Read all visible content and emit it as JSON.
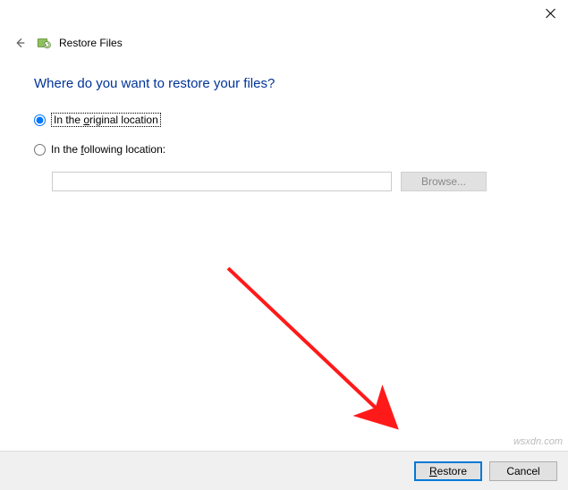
{
  "window": {
    "title": "Restore Files"
  },
  "heading": "Where do you want to restore your files?",
  "options": {
    "original": {
      "prefix": "In the ",
      "underlined": "o",
      "rest": "riginal location",
      "checked": true
    },
    "following": {
      "prefix": "In the ",
      "underlined": "f",
      "rest": "ollowing location:",
      "checked": false
    }
  },
  "path": {
    "value": ""
  },
  "buttons": {
    "browse": "Browse...",
    "restore_u": "R",
    "restore_rest": "estore",
    "cancel": "Cancel"
  },
  "watermark": "wsxdn.com"
}
